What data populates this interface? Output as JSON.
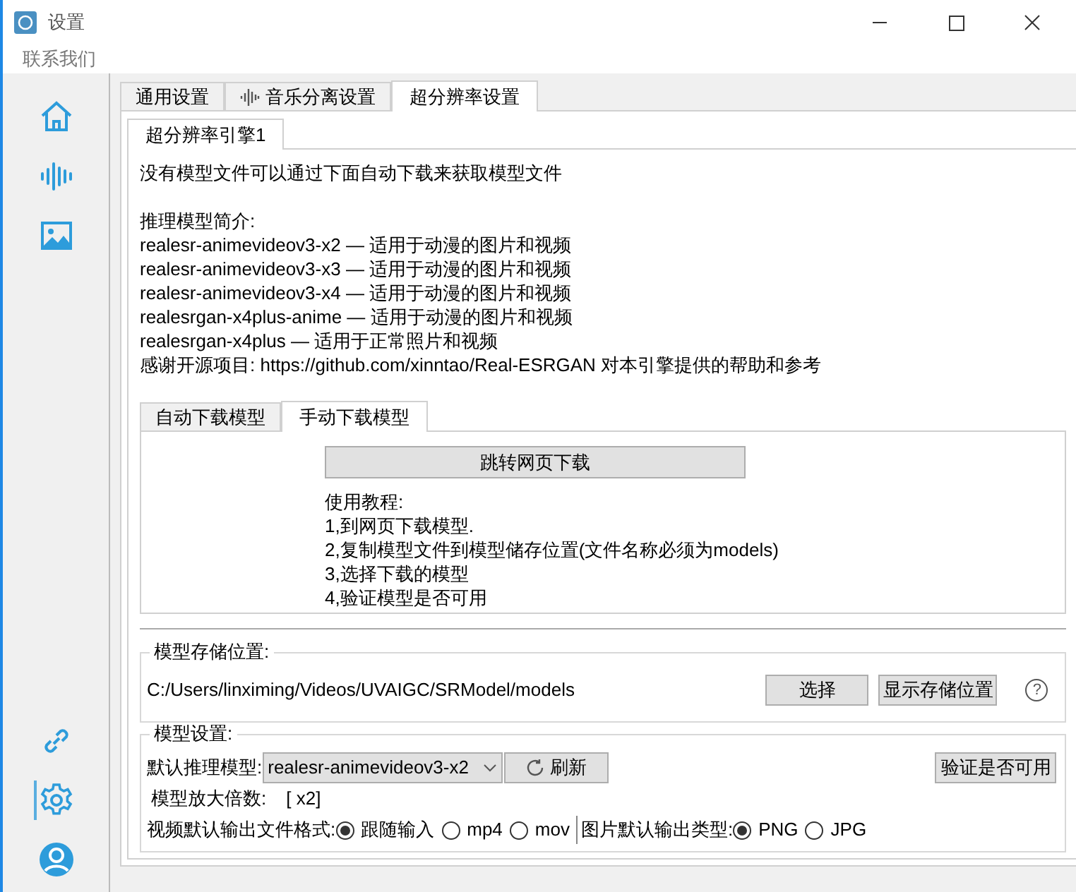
{
  "window": {
    "title": "设置"
  },
  "menu": [
    {
      "label": "联系我们"
    }
  ],
  "sidebar": {
    "items": [
      {
        "kind": "home",
        "selected": false
      },
      {
        "kind": "wave",
        "selected": false
      },
      {
        "kind": "image",
        "selected": false
      },
      {
        "kind": "spacer"
      },
      {
        "kind": "link",
        "selected": false
      },
      {
        "kind": "settings",
        "selected": true
      },
      {
        "kind": "user",
        "selected": false
      }
    ]
  },
  "tabs": [
    {
      "label": "通用设置",
      "kind": "plain",
      "selected": false
    },
    {
      "label": "音乐分离设置",
      "kind": "wave",
      "selected": false
    },
    {
      "label": "超分辨率设置",
      "kind": "plain",
      "selected": true
    }
  ],
  "engine_tabs": [
    {
      "label": "超分辨率引擎1",
      "selected": true
    }
  ],
  "notice": "没有模型文件可以通过下面自动下载来获取模型文件",
  "intro_title": "推理模型简介:",
  "model_lines": [
    "realesr-animevideov3-x2 — 适用于动漫的图片和视频",
    "realesr-animevideov3-x3 — 适用于动漫的图片和视频",
    "realesr-animevideov3-x4 — 适用于动漫的图片和视频",
    "realesrgan-x4plus-anime — 适用于动漫的图片和视频",
    "realesrgan-x4plus — 适用于正常照片和视频"
  ],
  "thanks": "感谢开源项目: https://github.com/xinntao/Real-ESRGAN 对本引擎提供的帮助和参考",
  "download_tabs": [
    {
      "label": "自动下载模型",
      "selected": false
    },
    {
      "label": "手动下载模型",
      "selected": true
    }
  ],
  "manual": {
    "button": "跳转网页下载",
    "tutorial_lines": [
      "使用教程:",
      "1,到网页下载模型.",
      "2,复制模型文件到模型储存位置(文件名称必须为models)",
      "3,选择下载的模型",
      "4,验证模型是否可用"
    ]
  },
  "storage": {
    "title": "模型存储位置:",
    "path": "C:/Users/linximing/Videos/UVAIGC/SRModel/models",
    "buttons": [
      "选择",
      "显示存储位置"
    ],
    "help": "?"
  },
  "model_settings": {
    "title": "模型设置:",
    "default_model_label": "默认推理模型:",
    "default_model": "realesr-animevideov3-x2",
    "refresh": "刷新",
    "verify": "验证是否可用",
    "scale_label": "模型放大倍数:",
    "scale_value": "[ x2]",
    "video_format_label": "视频默认输出文件格式:",
    "video_options": [
      {
        "label": "跟随输入",
        "selected": true
      },
      {
        "label": "mp4",
        "selected": false
      },
      {
        "label": "mov",
        "selected": false
      }
    ],
    "image_type_label": "图片默认输出类型:",
    "image_options": [
      {
        "label": "PNG",
        "selected": true
      },
      {
        "label": "JPG",
        "selected": false
      }
    ]
  }
}
